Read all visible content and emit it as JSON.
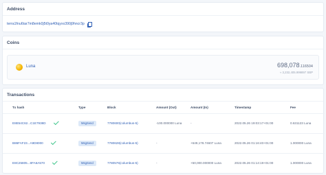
{
  "address": {
    "header": "Address",
    "value": "terra1fnu6tar7m8emk0j5t0ya40tqyxx390j9hncr3p"
  },
  "coins": {
    "header": "Coins",
    "items": [
      {
        "name": "Luna",
        "amount_int": "698,078",
        "amount_dec": ".116504",
        "value": "≈ 3,232,405.999897 SBP"
      }
    ]
  },
  "transactions": {
    "header": "Transactions",
    "columns": [
      "Tx hash",
      "Type",
      "Block",
      "Amount (Out)",
      "Amount (In)",
      "Timestamp",
      "Fee"
    ],
    "rows": [
      {
        "hash": "E8E54C62...C1E7938D",
        "type": "MsgSend",
        "block": "7780600(columbus-5)",
        "amount_out": "-100.000000 Luna",
        "amount_in": "-",
        "timestamp": "2022.05.26 19:03:17+01:00",
        "fee": "0.631123 Luna"
      },
      {
        "hash": "B86FAF23...A9D8000",
        "type": "MsgSend",
        "block": "7780628(columbus-5)",
        "amount_out": "-",
        "amount_in": "+649,178.74607 Luna",
        "timestamp": "2022.05.26 01:16:40+01:00",
        "fee": "1.000000 Luna"
      },
      {
        "hash": "E8C25805...8FA6A570",
        "type": "MsgSend",
        "block": "7780576(columbus-5)",
        "amount_out": "-",
        "amount_in": "+50,000.000000 Luna",
        "timestamp": "2022.05.26 01:14:19+01:00",
        "fee": "1.000000 Luna"
      }
    ]
  }
}
